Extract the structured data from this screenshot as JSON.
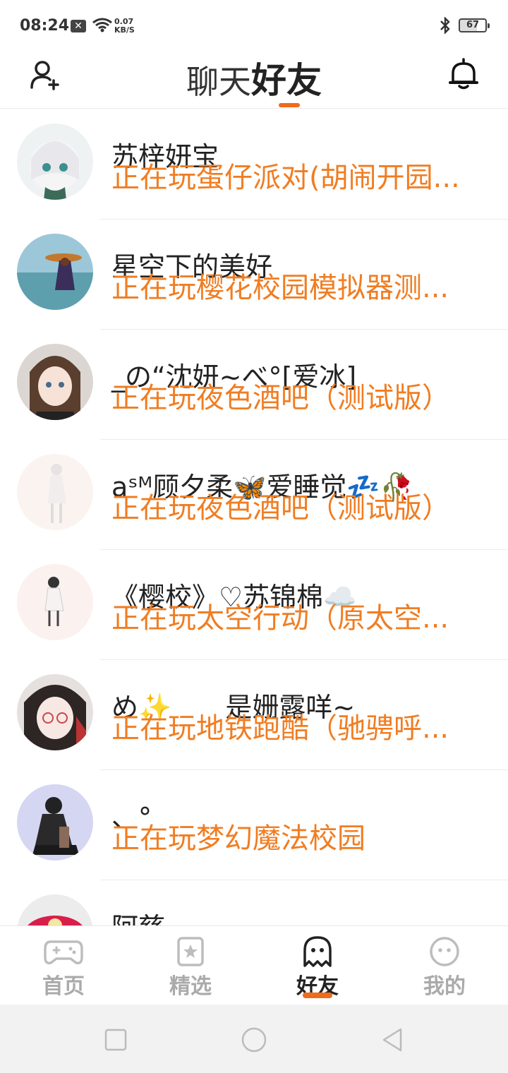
{
  "status_bar": {
    "time": "08:24",
    "notification_icon": "close-box-icon",
    "net_speed_value": "0.07",
    "net_speed_unit": "KB/S",
    "battery": "67"
  },
  "header": {
    "tab_chat": "聊天",
    "tab_friends": "好友",
    "left_icon": "add-friend-icon",
    "right_icon": "bell-icon",
    "accent_color": "#f06a1c"
  },
  "friends": [
    {
      "name": "苏梓妍宝",
      "status": "正在玩蛋仔派对(胡闹开园..."
    },
    {
      "name": "星空下的美好",
      "status": "正在玩樱花校园模拟器测..."
    },
    {
      "name": "_の“沈妍~べ°[爱冰]",
      "status": "正在玩夜色酒吧（测试版）"
    },
    {
      "name": "aˢᴹ顾夕柔🦋爱睡觉💤🥀",
      "status": "正在玩夜色酒吧（测试版）"
    },
    {
      "name": "《樱校》♡苏锦棉☁️",
      "status": "正在玩太空行动（原太空..."
    },
    {
      "name": "め✨　　是姗露咩~",
      "status": "正在玩地铁跑酷（驰骋呼..."
    },
    {
      "name": "、°",
      "status": "正在玩梦幻魔法校园"
    },
    {
      "name": "阿慈",
      "status": ""
    }
  ],
  "bottom_nav": [
    {
      "label": "首页",
      "icon": "gamepad-icon"
    },
    {
      "label": "精选",
      "icon": "star-card-icon"
    },
    {
      "label": "好友",
      "icon": "ghost-icon"
    },
    {
      "label": "我的",
      "icon": "face-icon"
    }
  ],
  "status_color": "#f07d22"
}
